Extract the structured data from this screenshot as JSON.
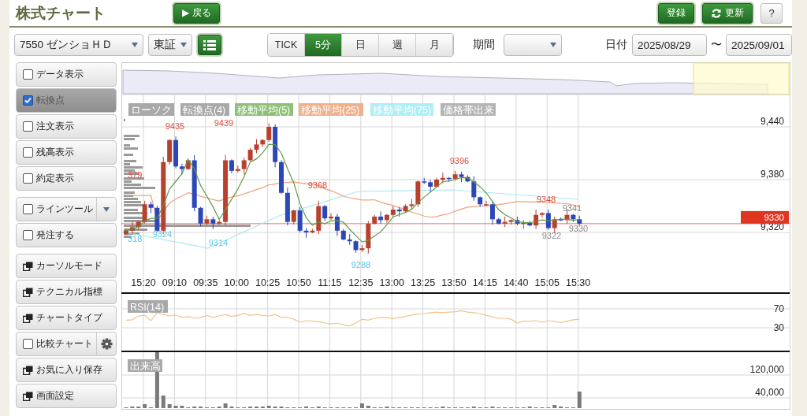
{
  "header": {
    "title": "株式チャート",
    "back_button": "▶ 戻る",
    "register_button": "登録",
    "refresh_button": "更新",
    "help_button": "?"
  },
  "toolbar": {
    "stock_select": "7550 ゼンショＨＤ",
    "market_select": "東証",
    "periods": [
      {
        "label": "TICK",
        "selected": false
      },
      {
        "label": "5分",
        "selected": true
      },
      {
        "label": "日",
        "selected": false
      },
      {
        "label": "週",
        "selected": false
      },
      {
        "label": "月",
        "selected": false
      }
    ],
    "range_label": "期間",
    "date_label": "日付",
    "date_from": "2025/08/29",
    "date_separator": "〜",
    "date_to": "2025/09/01"
  },
  "sidebar": {
    "groups": [
      {
        "items": [
          {
            "kind": "checkbox",
            "label": "データ表示",
            "checked": false
          },
          {
            "kind": "checkbox",
            "label": "転換点",
            "checked": true
          },
          {
            "kind": "checkbox",
            "label": "注文表示",
            "checked": false
          },
          {
            "kind": "checkbox",
            "label": "残高表示",
            "checked": false
          },
          {
            "kind": "checkbox",
            "label": "約定表示",
            "checked": false
          }
        ]
      },
      {
        "items": [
          {
            "kind": "checkbox-dropdown",
            "label": "ラインツール",
            "checked": false
          },
          {
            "kind": "checkbox",
            "label": "発注する",
            "checked": false
          }
        ]
      },
      {
        "items": [
          {
            "kind": "window",
            "label": "カーソルモード"
          },
          {
            "kind": "window",
            "label": "テクニカル指標"
          },
          {
            "kind": "window",
            "label": "チャートタイプ"
          },
          {
            "kind": "checkbox-gear",
            "label": "比較チャート",
            "checked": false
          },
          {
            "kind": "window",
            "label": "お気に入り保存"
          },
          {
            "kind": "window",
            "label": "画面設定"
          }
        ]
      }
    ]
  },
  "chart": {
    "legend": [
      {
        "label": "ローソク",
        "color": "#a9a9a9"
      },
      {
        "label": "転換点(4)",
        "color": "#a9a9a9"
      },
      {
        "label": "移動平均(5)",
        "color": "#8fc07a"
      },
      {
        "label": "移動平均(25)",
        "color": "#f0b08c"
      },
      {
        "label": "移動平均(75)",
        "color": "#aeeef6"
      },
      {
        "label": "価格帯出来",
        "color": "#b4b4b4"
      }
    ],
    "price_axis": [
      "9,440",
      "9,380",
      "9,320"
    ],
    "current_price": "9330",
    "time_axis": [
      "15:20",
      "09:10",
      "09:35",
      "10:00",
      "10:25",
      "10:50",
      "11:15",
      "12:35",
      "13:00",
      "13:25",
      "13:50",
      "14:15",
      "14:40",
      "15:05",
      "15:30"
    ],
    "price_labels": [
      {
        "text": "9435",
        "kind": "high"
      },
      {
        "text": "9439",
        "kind": "high"
      },
      {
        "text": "379",
        "kind": "high"
      },
      {
        "text": "9368",
        "kind": "high"
      },
      {
        "text": "9396",
        "kind": "high"
      },
      {
        "text": "9348",
        "kind": "high"
      },
      {
        "text": "9341",
        "kind": "other"
      },
      {
        "text": "9324",
        "kind": "low"
      },
      {
        "text": "9314",
        "kind": "low"
      },
      {
        "text": "9288",
        "kind": "low"
      },
      {
        "text": "318",
        "kind": "low"
      },
      {
        "text": "9322",
        "kind": "other"
      },
      {
        "text": "9330",
        "kind": "other"
      }
    ],
    "rsi": {
      "label": "RSI(14)",
      "axis": [
        "70",
        "30"
      ]
    },
    "volume": {
      "label": "出来高",
      "axis": [
        "120,000",
        "40,000"
      ]
    }
  }
}
